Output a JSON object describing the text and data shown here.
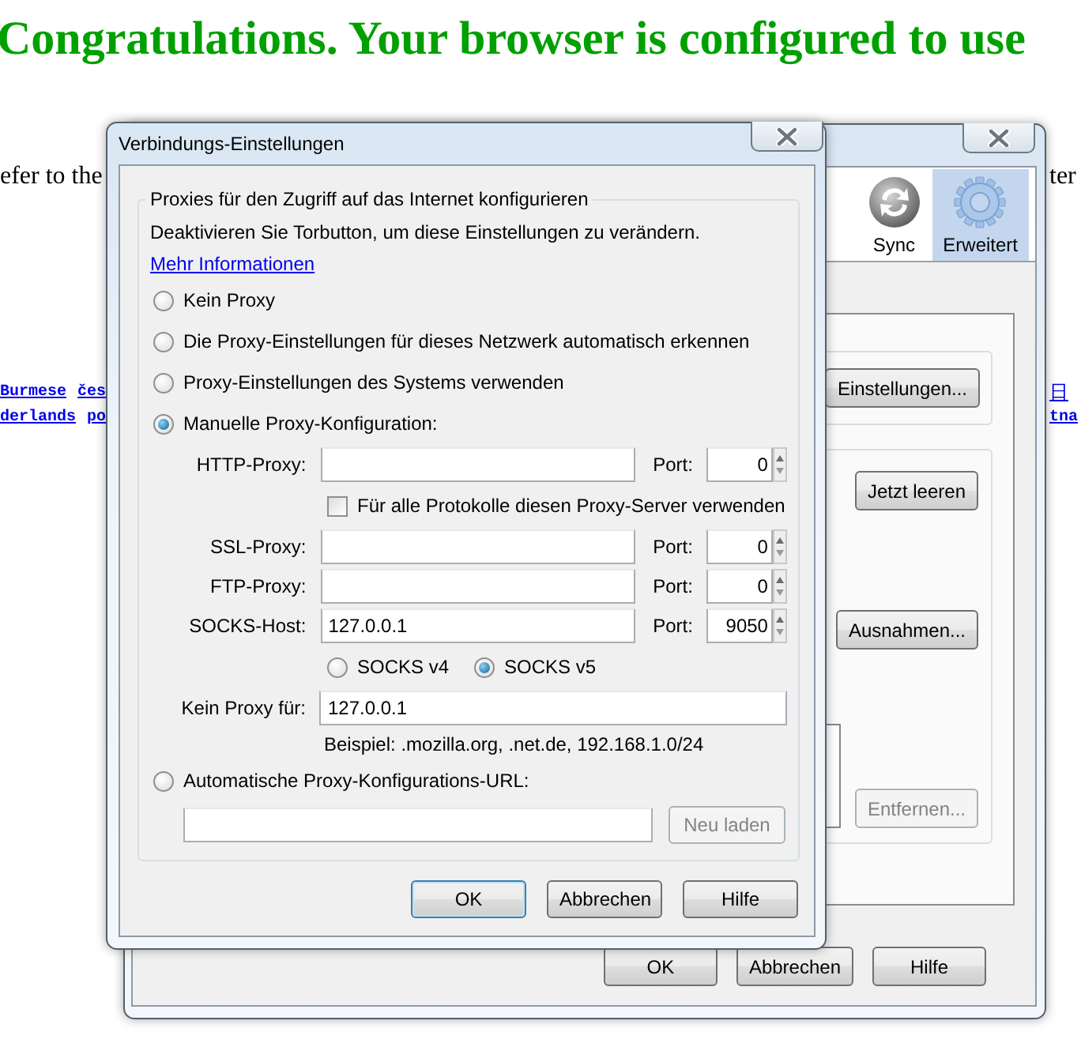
{
  "page": {
    "heading": "Congratulations. Your browser is configured to use",
    "text_left": "efer to the",
    "text_right": "ter",
    "links_left": [
      [
        "Burmese",
        "čes"
      ],
      [
        "derlands",
        "po"
      ]
    ],
    "links_right": [
      "日",
      "tna"
    ]
  },
  "options_window": {
    "toolbar": [
      {
        "label": "Sync",
        "selected": false
      },
      {
        "label": "Erweitert",
        "selected": true
      }
    ],
    "group_buttons": [
      {
        "label": "Einstellungen...",
        "disabled": false
      },
      {
        "label": "Jetzt leeren",
        "disabled": false
      },
      {
        "label": "Ausnahmen...",
        "disabled": false
      },
      {
        "label": "Entfernen...",
        "disabled": true
      }
    ],
    "buttons": [
      "OK",
      "Abbrechen",
      "Hilfe"
    ]
  },
  "dialog": {
    "title": "Verbindungs-Einstellungen",
    "group_title": "Proxies für den Zugriff auf das Internet konfigurieren",
    "notice": "Deaktivieren Sie Torbutton, um diese Einstellungen zu verändern.",
    "link": "Mehr Informationen",
    "modes": [
      {
        "label": "Kein Proxy",
        "selected": false
      },
      {
        "label": "Die Proxy-Einstellungen für dieses Netzwerk automatisch erkennen",
        "selected": false
      },
      {
        "label": "Proxy-Einstellungen des Systems verwenden",
        "selected": false
      },
      {
        "label": "Manuelle Proxy-Konfiguration:",
        "selected": true
      },
      {
        "label": "Automatische Proxy-Konfigurations-URL:",
        "selected": false
      }
    ],
    "proxies": [
      {
        "label": "HTTP-Proxy:",
        "port_label": "Port:",
        "port": "0"
      },
      {
        "label": "SSL-Proxy:",
        "port_label": "Port:",
        "port": "0"
      },
      {
        "label": "FTP-Proxy:",
        "port_label": "Port:",
        "port": "0"
      },
      {
        "label": "SOCKS-Host:",
        "value": "127.0.0.1",
        "port_label": "Port:",
        "port": "9050"
      }
    ],
    "share_all": {
      "label": "Für alle Protokolle diesen Proxy-Server verwenden",
      "checked": false
    },
    "socks_versions": [
      {
        "label": "SOCKS v4",
        "selected": false
      },
      {
        "label": "SOCKS v5",
        "selected": true
      }
    ],
    "no_proxy": {
      "label": "Kein Proxy für:",
      "value": "127.0.0.1"
    },
    "example": "Beispiel: .mozilla.org, .net.de, 192.168.1.0/24",
    "reload_button": {
      "label": "Neu laden",
      "disabled": true
    },
    "buttons": [
      {
        "label": "OK",
        "focused": true
      },
      {
        "label": "Abbrechen",
        "focused": false
      },
      {
        "label": "Hilfe",
        "focused": false
      }
    ]
  }
}
